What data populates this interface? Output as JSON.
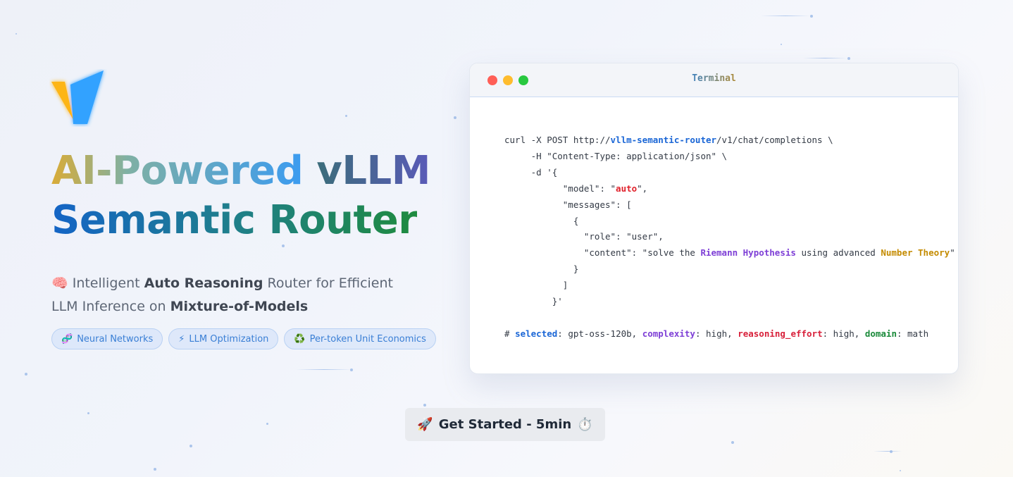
{
  "hero": {
    "title_line1_a": "AI-Powered",
    "title_line1_b": "vLLM",
    "title_line2": "Semantic Router",
    "tagline": {
      "icon": "🧠",
      "t1": " Intelligent ",
      "b1": "Auto Reasoning",
      "t2": " Router for Efficient LLM Inference on ",
      "b2": "Mixture-of-Models"
    },
    "chips": [
      {
        "icon": "🧬",
        "label": "Neural Networks"
      },
      {
        "icon": "⚡",
        "label": "LLM Optimization"
      },
      {
        "icon": "♻️",
        "label": "Per-token Unit Economics"
      }
    ]
  },
  "terminal": {
    "title": "Terminal",
    "l1_a": "curl -X POST http://",
    "l1_url": "vllm-semantic-router",
    "l1_b": "/v1/chat/completions \\",
    "l2": "     -H \"Content-Type: application/json\" \\",
    "l3": "     -d '{",
    "l4_a": "           \"model\": \"",
    "l4_b": "auto",
    "l4_c": "\",",
    "l5": "           \"messages\": [",
    "l6": "             {",
    "l7": "               \"role\": \"user\",",
    "l8_a": "               \"content\": \"solve the ",
    "l8_b": "Riemann Hypothesis",
    "l8_c": " using advanced ",
    "l8_d": "Number Theory",
    "l8_e": "\"",
    "l9": "             }",
    "l10": "           ]",
    "l11": "         }'",
    "l12_a": "# ",
    "l12_sel": "selected",
    "l12_b": ": gpt-oss-120b, ",
    "l12_cx": "complexity",
    "l12_c": ": high, ",
    "l12_re": "reasoning_effort",
    "l12_d": ": high, ",
    "l12_do": "domain",
    "l12_e": ": math"
  },
  "cta": {
    "icon": "🚀",
    "label": "Get Started - 5min",
    "timer_icon": "⏱️"
  },
  "colors": {
    "chip_text": "#3a7fd5",
    "url_blue": "#1a66d6",
    "accent_red": "#e0202a",
    "accent_purple": "#7e3fd6",
    "accent_gold": "#c48b00",
    "accent_green": "#1a8a3a"
  }
}
